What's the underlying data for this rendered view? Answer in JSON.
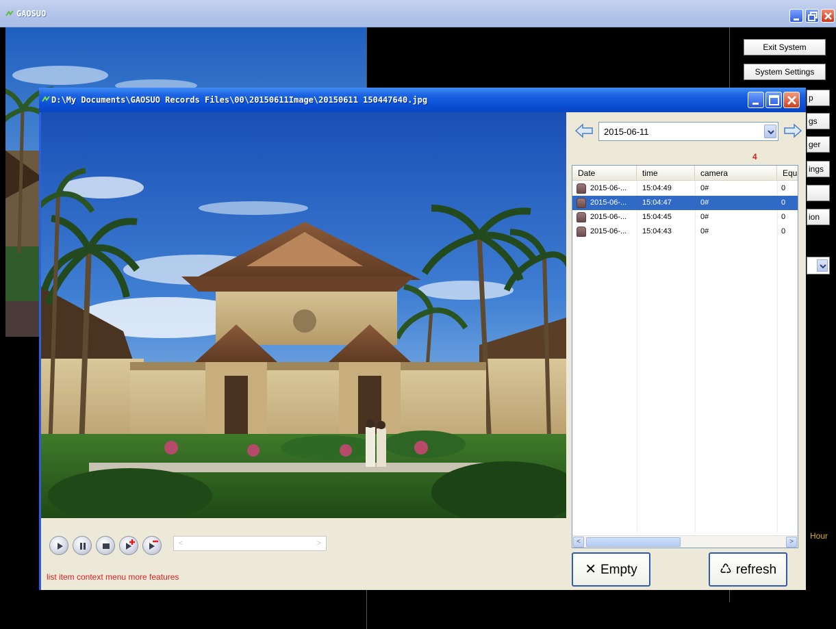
{
  "app": {
    "title": "GAOSUO"
  },
  "side_buttons": {
    "exit": "Exit System",
    "settings": "System Settings",
    "stub1": "p",
    "stub2": "gs",
    "stub3": "ger",
    "stub4": "ings",
    "stub5": "",
    "stub6": "ion",
    "hours": "Hour"
  },
  "dialog": {
    "title": "D:\\My Documents\\GAOSUO Records Files\\00\\20150611Image\\20150611 150447640.jpg",
    "date_value": "2015-06-11",
    "count": "4",
    "columns": [
      "Date",
      "time",
      "camera",
      "Equ"
    ],
    "rows": [
      {
        "date": "2015-06-...",
        "time": "15:04:49",
        "camera": "0#",
        "equ": "0",
        "selected": false
      },
      {
        "date": "2015-06-...",
        "time": "15:04:47",
        "camera": "0#",
        "equ": "0",
        "selected": true
      },
      {
        "date": "2015-06-...",
        "time": "15:04:45",
        "camera": "0#",
        "equ": "0",
        "selected": false
      },
      {
        "date": "2015-06-...",
        "time": "15:04:43",
        "camera": "0#",
        "equ": "0",
        "selected": false
      }
    ],
    "empty_label": "Empty",
    "refresh_label": "refresh",
    "hint": "list item context menu more features",
    "slider_left": "<",
    "slider_right": ">"
  },
  "colors": {
    "title_blue": "#0a4fd4",
    "selection": "#316ac5",
    "hint_red": "#e02020",
    "hours_yellow": "#e1b400"
  }
}
